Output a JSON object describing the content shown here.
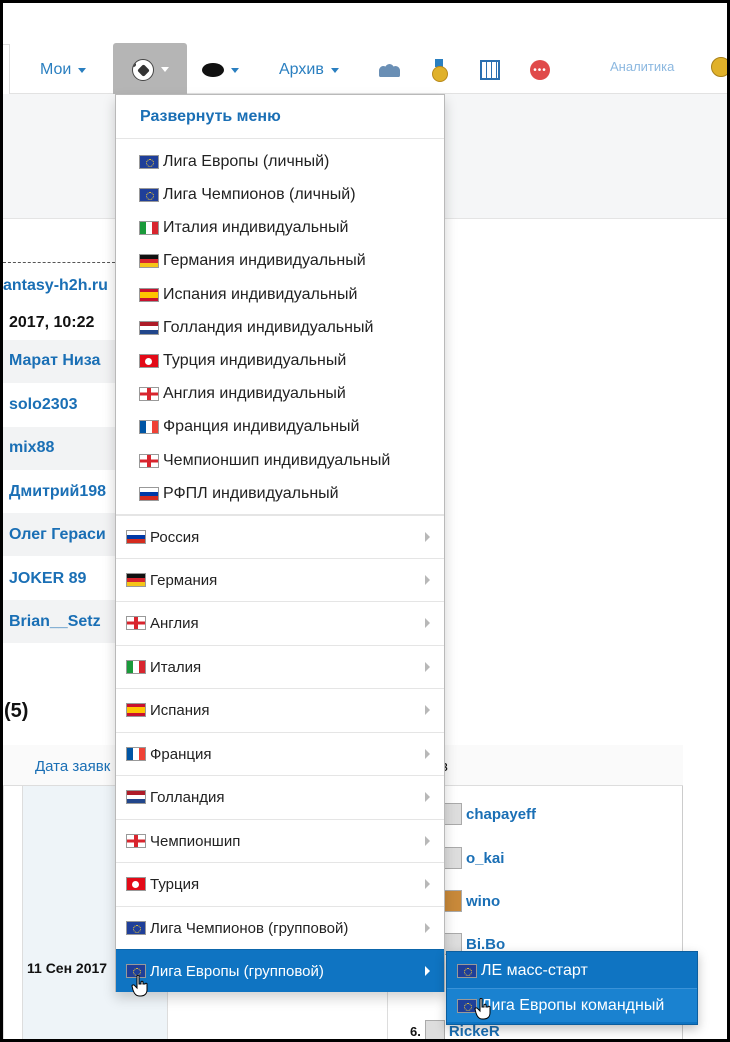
{
  "nav": {
    "moi_label": "Мои",
    "archive_label": "Архив",
    "analytics_label": "Аналитика",
    "icons": [
      "soccer-ball-icon",
      "hockey-puck-icon",
      "users-icon",
      "medal-icon",
      "table-icon",
      "chat-icon",
      "coins-icon"
    ]
  },
  "background": {
    "site_fragment": "antasy-h2h.ru",
    "datetime_fragment": "2017, 10:22",
    "players": [
      "Марат Низа",
      "solo2303",
      "mix88",
      "Дмитрий198",
      "Олег Гераси",
      "JOKER 89",
      "Brian__Setz"
    ],
    "section_title": "(5)",
    "table": {
      "col_date_header": "Дата заявк",
      "col_right_header": "в",
      "date_cell": "11 Сен 2017",
      "users": [
        "chapayeff",
        "o_kai",
        "wino",
        "Bi.Bo",
        "RickeR"
      ],
      "last_rank": "6."
    }
  },
  "dropdown": {
    "header": "Развернуть меню",
    "individual": [
      {
        "label": "Лига Европы (личный)",
        "flag": "eu"
      },
      {
        "label": "Лига Чемпионов (личный)",
        "flag": "eu"
      },
      {
        "label": "Италия индивидуальный",
        "flag": "it"
      },
      {
        "label": "Германия индивидуальный",
        "flag": "de"
      },
      {
        "label": "Испания индивидуальный",
        "flag": "es"
      },
      {
        "label": "Голландия индивидуальный",
        "flag": "nl"
      },
      {
        "label": "Турция индивидуальный",
        "flag": "tr"
      },
      {
        "label": "Англия индивидуальный",
        "flag": "en"
      },
      {
        "label": "Франция индивидуальный",
        "flag": "fr"
      },
      {
        "label": "Чемпионшип индивидуальный",
        "flag": "en"
      },
      {
        "label": "РФПЛ индивидуальный",
        "flag": "ru"
      }
    ],
    "submenus": [
      {
        "label": "Россия",
        "flag": "ru"
      },
      {
        "label": "Германия",
        "flag": "de"
      },
      {
        "label": "Англия",
        "flag": "en"
      },
      {
        "label": "Италия",
        "flag": "it"
      },
      {
        "label": "Испания",
        "flag": "es"
      },
      {
        "label": "Франция",
        "flag": "fr"
      },
      {
        "label": "Голландия",
        "flag": "nl"
      },
      {
        "label": "Чемпионшип",
        "flag": "en"
      },
      {
        "label": "Турция",
        "flag": "tr"
      },
      {
        "label": "Лига Чемпионов (групповой)",
        "flag": "eu"
      },
      {
        "label": "Лига Европы (групповой)",
        "flag": "eu",
        "active": true
      }
    ]
  },
  "submenu": {
    "items": [
      {
        "label": "ЛЕ масс-старт",
        "flag": "eu"
      },
      {
        "label": "Лига Европы командный",
        "flag": "eu",
        "hover": true
      }
    ]
  },
  "colors": {
    "link_blue": "#1a6fb5",
    "active_blue": "#0f74c2",
    "nav_active_gray": "#b5b5b5"
  }
}
